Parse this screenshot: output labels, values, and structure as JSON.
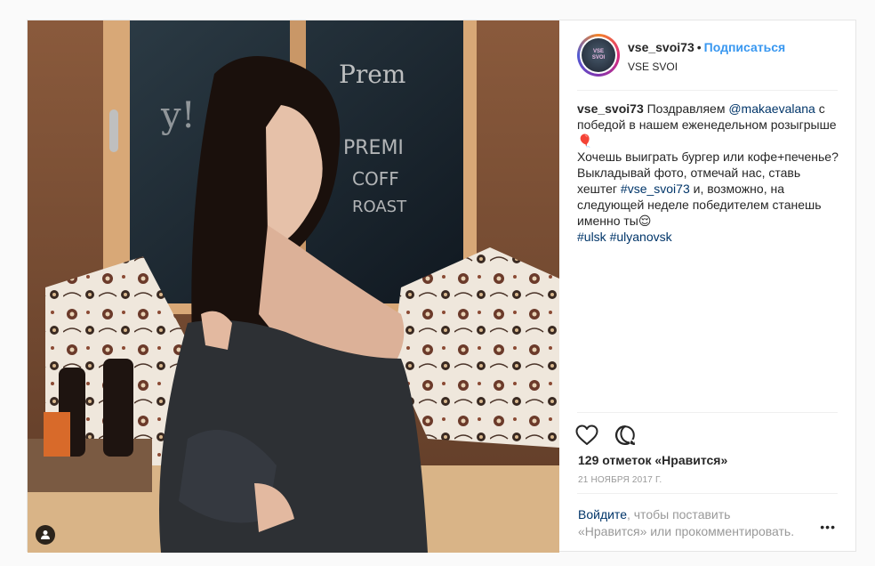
{
  "header": {
    "username": "vse_svoi73",
    "separator": "•",
    "follow_label": "Подписаться",
    "location": "VSE SVOI",
    "avatar_text_top": "VSE",
    "avatar_text_bottom": "SVOI"
  },
  "caption": {
    "username": "vse_svoi73",
    "text_1": " Поздравляем ",
    "mention": "@makaevalana",
    "text_2": " с победой в нашем еженедельном розыгрыше",
    "emoji_balloon": "🎈",
    "text_3": "Хочешь выиграть бургер или кофе+печенье? Выкладывай фото, отмечай нас, ставь хештег ",
    "hashtag_main": "#vse_svoi73",
    "text_4": " и, возможно, на следующей неделе победителем станешь именно ты",
    "emoji_smile": "😌",
    "hashtag_1": "#ulsk",
    "hashtag_2": "#ulyanovsk"
  },
  "actions": {
    "like_icon": "heart-outline-icon",
    "comment_icon": "speech-bubble-icon",
    "likes_text": "129 отметок «Нравится»",
    "date": "21 ноября 2017 г."
  },
  "login": {
    "link_text": "Войдите",
    "text_1": ", чтобы поставить",
    "text_2": "«Нравится» или прокомментировать.",
    "more_label": "•••"
  },
  "colors": {
    "accent": "#3897f0",
    "link": "#003569",
    "muted": "#999999",
    "border": "#efefef"
  }
}
